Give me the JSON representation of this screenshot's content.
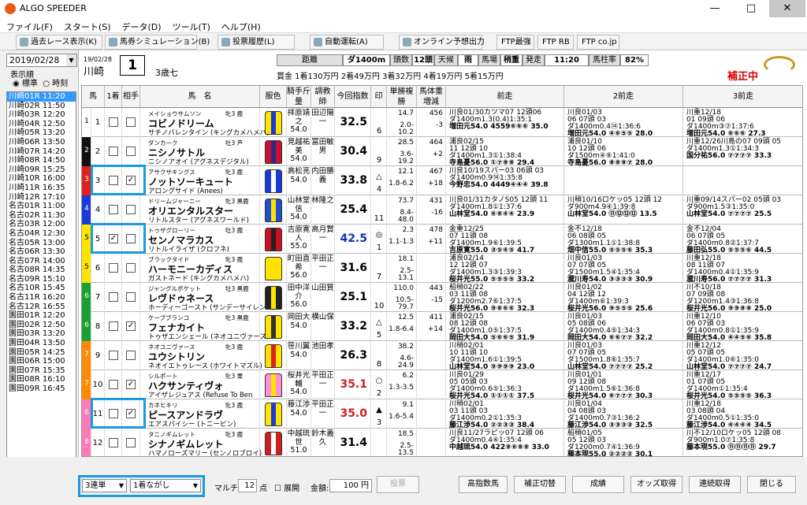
{
  "app": {
    "title": "ALGO SPEEDER"
  },
  "menu": [
    "ファイル(F)",
    "スタート(S)",
    "データ(D)",
    "ツール(T)",
    "ヘルプ(H)"
  ],
  "toolbar": [
    "過去レース表示(K)",
    "馬券シミュレーション(B)",
    "投票履歴(L)",
    "自動運転(A)",
    "オンライン予想出力",
    "FTP最強",
    "FTP RB",
    "FTP co.jp"
  ],
  "left": {
    "date": "2019/02/28",
    "order_label": "表示順",
    "radio1": "標準",
    "radio2": "時刻",
    "races": [
      "川崎01R 11:20",
      "川崎02R 11:50",
      "川崎03R 12:20",
      "川崎04R 12:50",
      "川崎05R 13:20",
      "川崎06R 13:50",
      "川崎07R 14:20",
      "川崎08R 14:50",
      "川崎09R 15:25",
      "川崎10R 16:00",
      "川崎11R 16:35",
      "川崎12R 17:10",
      "名古01R 11:00",
      "名古02R 11:30",
      "名古03R 12:00",
      "名古04R 12:30",
      "名古05R 13:00",
      "名古06R 13:30",
      "名古07R 14:00",
      "名古08R 14:35",
      "名古09R 15:10",
      "名古10R 15:45",
      "名古11R 16:20",
      "名古12R 16:55",
      "園田01R 12:20",
      "園田02R 12:50",
      "園田03R 13:20",
      "園田04R 13:50",
      "園田05R 14:25",
      "園田06R 15:00",
      "園田07R 15:35",
      "園田08R 16:10",
      "園田09R 16:45"
    ]
  },
  "race": {
    "date": "19/02/28",
    "venue": "川崎",
    "number": "1",
    "class": "3歳七",
    "info": [
      "距離",
      "ダ1400m",
      "頭数",
      "12頭",
      "天候",
      "雨",
      "馬場",
      "稍重",
      "発走",
      "11:20",
      "馬柱率",
      "82%"
    ],
    "prize": "賞金 1着130万円 2着49万円 3着32万円 4着19万円 5着15万円",
    "status": "補正中"
  },
  "columns": [
    "馬",
    "1着",
    "相手",
    "馬　名",
    "服色",
    "騎手斤量",
    "調教師",
    "今回指数",
    "印",
    "単勝複勝",
    "馬体重増減",
    "前走",
    "2前走",
    "3前走"
  ],
  "horses": [
    {
      "no": "1",
      "c1": false,
      "c2": false,
      "sire": "メイショウサムソン",
      "sex": "牝3 鹿",
      "name": "コビノドリーム",
      "dam": "サチノバレンタイン (キングカメハメハ)",
      "jockey": "拝原靖之",
      "kin": "54.0",
      "trainer": "田辺陽一",
      "index": "32.5",
      "mark": "",
      "pop": "6",
      "odds": "14.7",
      "place": "2.0-10.2",
      "weight": "456",
      "diff": "-3",
      "p1": [
        "川良01/30カツマ07 12頭06",
        "ダ1400m1.3(0.4)1:35:1",
        "増田元54.0 4559⑥⑥⑥ 35.0"
      ],
      "p2": [
        "川良01/03",
        "06 07頭 03",
        "ダ1400m0.4⑭1:36:6",
        "増田元54.0 ④⑥⑤⑤ 28.0"
      ],
      "p3": [
        "川重12/18",
        "01 09頭 06",
        "ダ1400m③⑦1:37:6",
        "増田元54.0 ⑥⑥⑥ 27.3"
      ]
    },
    {
      "no": "2",
      "c1": false,
      "c2": false,
      "sire": "ダンカーク",
      "sex": "牡3 芦",
      "name": "ニシノサトル",
      "dam": "ニシノアオイ (アグネスデジタル)",
      "jockey": "見越祐美",
      "kin": "54.0",
      "trainer": "冨田敏男",
      "index": "30.4",
      "mark": "",
      "pop": "9",
      "odds": "28.5",
      "place": "3.6-19.2",
      "weight": "464",
      "diff": "+2",
      "p1": [
        "浦良02/15",
        "11 12頭 10",
        "ダ1400m1.3①1:38:4",
        "寺島憂56.0 ①⑦⑧⑧ 29.4"
      ],
      "p2": [
        "浦良01/10",
        "10 12頭 06",
        "ダ1500m④⑥1:41:0",
        "寺島憂56.0 ⑧⑧⑧⑦ 28.0"
      ],
      "p3": [
        "川重12/26川島の07 09頭 05",
        "ダ1400m1.3①1:34:3",
        "国分祐56.0 ⑦⑦⑦⑦ 33.3"
      ]
    },
    {
      "no": "3",
      "c1": false,
      "c2": true,
      "sire": "アサクサキングス",
      "sex": "牝3 鹿",
      "name": "ノットソーキュート",
      "dam": "アロングサイド (Anees)",
      "jockey": "高松亮",
      "kin": "54.0",
      "trainer": "内田勝義",
      "index": "33.8",
      "mark": "△",
      "pop": "4",
      "odds": "12.1",
      "place": "1.8-6.2",
      "weight": "467",
      "diff": "+18",
      "p1": [
        "川良10/19スパー03 06頭 03",
        "ダ1400m0.9⑭1:35:8",
        "今野忠54.0 4449④④④ 39.8"
      ],
      "p2": [
        "",
        "",
        "",
        ""
      ],
      "p3": [
        "",
        "",
        "",
        ""
      ]
    },
    {
      "no": "4",
      "c1": false,
      "c2": false,
      "sire": "ドリームジャーニー",
      "sex": "牝3 黒鹿",
      "name": "オリエンタルスター",
      "dam": "リトルスター (アグネスワールド)",
      "jockey": "山林堂信",
      "kin": "54.0",
      "trainer": "林隆之",
      "index": "25.4",
      "mark": "",
      "pop": "11",
      "odds": "73.7",
      "place": "8.4-48.0",
      "weight": "431",
      "diff": "-16",
      "p1": [
        "川良01/31カタノS05 12頭 11",
        "ダ1400m1.8①1:37:6",
        "山林堂54.0 ⑥⑧④④ 23.9"
      ],
      "p2": [
        "川稍10/16ロケッ05 12頭 12",
        "ダ900m4.9④1:39:8",
        "山林堂54.0 ⑪⑫⑫⑫ 13.5"
      ],
      "p3": [
        "川重09/14スパー02 05頭 03",
        "ダ900m1.5③1:35:0",
        "山林堂54.0 ⑦⑦⑦⑦ 25.5"
      ]
    },
    {
      "no": "5",
      "c1": true,
      "c2": false,
      "sire": "トゥザグローリー",
      "sex": "牡3 鹿",
      "name": "センノマラカス",
      "dam": "リトルイライザ (クロフネ)",
      "jockey": "吉原寛人",
      "kin": "55.0",
      "trainer": "高月賢一",
      "index": "42.5",
      "mark": "◎",
      "pop": "1",
      "odds": "2.3",
      "place": "1.1-1.3",
      "weight": "478",
      "diff": "+11",
      "p1": [
        "金重12/25",
        "07 11頭 08",
        "ダ1400m1.9⑥1:39:5",
        "吉原寛55.0 ③⑤④⑤ 41.7"
      ],
      "p2": [
        "金不12/18",
        "06 08頭 05",
        "ダ1300m1.1①1:38:8",
        "畑中信55.0 ⑤⑤⑤⑥ 35.3"
      ],
      "p3": [
        "金不12/04",
        "06 07頭 05",
        "ダ1400m0.8②1:37:7",
        "藤田弘55.0 ⑤⑤⑤⑥ 44.5"
      ]
    },
    {
      "no": "6",
      "c1": false,
      "c2": false,
      "sire": "ブラックタイド",
      "sex": "牝3 鹿",
      "name": "ハーモニーカディス",
      "dam": "ガストネード (キングカメハメハ)",
      "jockey": "町田直希",
      "kin": "56.0",
      "trainer": "平田正一",
      "index": "31.6",
      "mark": "",
      "pop": "7",
      "odds": "18.1",
      "place": "2.5-13.1",
      "weight": "",
      "diff": "",
      "p1": [
        "浦良02/14",
        "12 12頭 07",
        "ダ1400m1.3③1:39:3",
        "桜井光55.0 ⑤⑤⑤⑤ 33.2"
      ],
      "p2": [
        "川良01/03",
        "07 07頭 05",
        "ダ1500m1.5④1:35:4",
        "瀧川寿54.0 ③③③③ 30.9"
      ],
      "p3": [
        "川重12/18",
        "08 11頭 07",
        "ダ1400m0.4①1:35:9",
        "瀧川寿56.0 ⑦⑦⑦⑦ 31.3"
      ]
    },
    {
      "no": "7",
      "c1": false,
      "c2": false,
      "sire": "ジャングルポケット",
      "sex": "牡3 黒鹿",
      "name": "レヴドゥネース",
      "dam": "ホーディーゴースト (サンデーサイレンス)",
      "jockey": "田中洋介",
      "kin": "56.0",
      "trainer": "山田質",
      "index": "25.1",
      "mark": "",
      "pop": "10",
      "odds": "110.0",
      "place": "10.5-79.7",
      "weight": "443",
      "diff": "-15",
      "p1": [
        "船稍02/22",
        "03 11頭 08",
        "ダ1200m2.7⑥1:37:5",
        "桜井光56.0 ⑨⑧⑥⑥ 32.3"
      ],
      "p2": [
        "川良01/02",
        "04 12頭 12",
        "ダ1400m⑥1:39:3",
        "桜井光56.0 ⑨⑤⑤⑤ 25.6"
      ],
      "p3": [
        "川不10/18",
        "07 09頭 08",
        "ダ1200m1.4③1:36:8",
        "桜井光56.0 ⑨⑨⑧⑧ 25.0"
      ]
    },
    {
      "no": "8",
      "c1": false,
      "c2": true,
      "sire": "ケープブランコ",
      "sex": "牝3 黒鹿",
      "name": "フェナカイト",
      "dam": "トゥザエンシェール (ネオユニヴァース)",
      "jockey": "岡田大",
      "kin": "54.0",
      "trainer": "横山保",
      "index": "33.2",
      "mark": "△",
      "pop": "5",
      "odds": "12.5",
      "place": "1.8-6.4",
      "weight": "411",
      "diff": "+14",
      "p1": [
        "浦良02/15",
        "08 12頭 08",
        "ダ1400m1.0⑤1:37:5",
        "岡田大54.0 ⑤⑥⑥⑤ 31.9"
      ],
      "p2": [
        "川良01/03",
        "05 08頭 06",
        "ダ1400m0.4⑤1:34:3",
        "岡田大54.0 ⑥⑥⑦⑦ 32.2"
      ],
      "p3": [
        "川重12/10",
        "06 07頭 03",
        "ダ1400m0.8①1:35:9",
        "岡田大54.0 ④④⑤⑥ 35.8"
      ]
    },
    {
      "no": "9",
      "c1": false,
      "c2": false,
      "sire": "ネオユニヴァース",
      "sex": "牝3 鹿",
      "name": "ユウシトリン",
      "dam": "ネオイエトゥレース (ホワイトマズル)",
      "jockey": "笹川翼",
      "kin": "54.0",
      "trainer": "池田孝",
      "index": "26.3",
      "mark": "",
      "pop": "8",
      "odds": "38.2",
      "place": "4.6-24.9",
      "weight": "",
      "diff": "",
      "p1": [
        "川稍02/01",
        "10 11頭 10",
        "ダ1400m1.6①1:39:5",
        "山林堂54.0 ⑨⑨⑨⑨ 23.0"
      ],
      "p2": [
        "川良01/03",
        "07 07頭 05",
        "ダ1500m1.8⑥1:35:7",
        "山林堂54.0 ⑦⑦⑦⑦ 25.2"
      ],
      "p3": [
        "川重12/12",
        "05 07頭 05",
        "ダ1400m1.0⑥1:35:0",
        "山林堂54.0 ⑦⑦⑦⑦ 24.7"
      ]
    },
    {
      "no": "10",
      "c1": false,
      "c2": true,
      "sire": "シルポート",
      "sex": "牝3 栗",
      "name": "ハクサンティヴォ",
      "dam": "アイザレジュアス (Refuse To Ben",
      "jockey": "桜井光輔",
      "kin": "54.0",
      "trainer": "平田正一",
      "index": "35.1",
      "mark": "○",
      "pop": "2",
      "odds": "6.2",
      "place": "1.3-3.5",
      "weight": "",
      "diff": "",
      "p1": [
        "川良01/29",
        "05 05頭 03",
        "ダ1400m0.6⑤1:36:3",
        "桜井光54.0 ①①①① 37.5"
      ],
      "p2": [
        "川良01/01",
        "09 12頭 08",
        "ダ1400m1.5⑥1:36:8",
        "桜井光54.0 ⑥⑦⑦⑦ 30.3"
      ],
      "p3": [
        "川重12/17",
        "01 07頭 05",
        "ダ1400m①1:35:4",
        "桜井光54.0 ⑤⑤⑤⑤ 36.3"
      ]
    },
    {
      "no": "11",
      "c1": false,
      "c2": true,
      "sire": "カネヒキリ",
      "sex": "牝3 鹿",
      "name": "ピースアンドラヴ",
      "dam": "エアスパイシー (トニービン)",
      "jockey": "藤江渉",
      "kin": "54.0",
      "trainer": "平田正一",
      "index": "35.0",
      "mark": "▲",
      "pop": "3",
      "odds": "9.1",
      "place": "1.6-5.4",
      "weight": "",
      "diff": "",
      "p1": [
        "川稍02/01",
        "03 11頭 03",
        "ダ1400m0.2①1:35:3",
        "藤江渉54.0 ②②③③ 38.4"
      ],
      "p2": [
        "川良01/04",
        "04 08頭 03",
        "ダ1400m0.7③1:36:2",
        "藤江渉54.0 ③③③③ 32.5"
      ],
      "p3": [
        "川重12/18",
        "03 08頭 04",
        "ダ1400m0.5①1:35:0",
        "藤江渉54.0 ④④④④ 34.5"
      ]
    },
    {
      "no": "12",
      "c1": false,
      "c2": false,
      "sire": "タニノギムレット",
      "sex": "牝3 鹿",
      "name": "シナノギムレット",
      "dam": "ハマノローズマリー (センノロブロイ)",
      "jockey": "中越琉世",
      "kin": "51.0",
      "trainer": "鈴木義久",
      "index": "31.4",
      "mark": "",
      "pop": "",
      "odds": "18.5",
      "place": "2.5-13.5",
      "weight": "",
      "diff": "",
      "p1": [
        "川良11/27ラピッ07 12頭 06",
        "ダ1400m0.4④1:35:4",
        "中越琉54.0 422⑧⑥⑧⑧ 33.0"
      ],
      "p2": [
        "船稍01/05",
        "05 12頭 03",
        "ダ1200m0.7④1:36:9",
        "藤本現55.0 ②②②② 30.1"
      ],
      "p3": [
        "川不12/10ロケッ05 12頭 08",
        "ダ900m1.0⑦1:35:8",
        "藤本現55.0 ⑪⑪⑪⑪ 29.7"
      ]
    }
  ],
  "bottom": {
    "bet_type": "3連単",
    "bet_method": "1着ながし",
    "marchi": "マルチ",
    "points": "12",
    "points_unit": "点",
    "expand": "展開",
    "amount_label": "金額:",
    "amount": "100",
    "yen": "円",
    "vote": "投票",
    "buttons": [
      "高指数馬",
      "補正切替",
      "成績",
      "オッズ取得",
      "連続取得",
      "閉じる"
    ]
  }
}
